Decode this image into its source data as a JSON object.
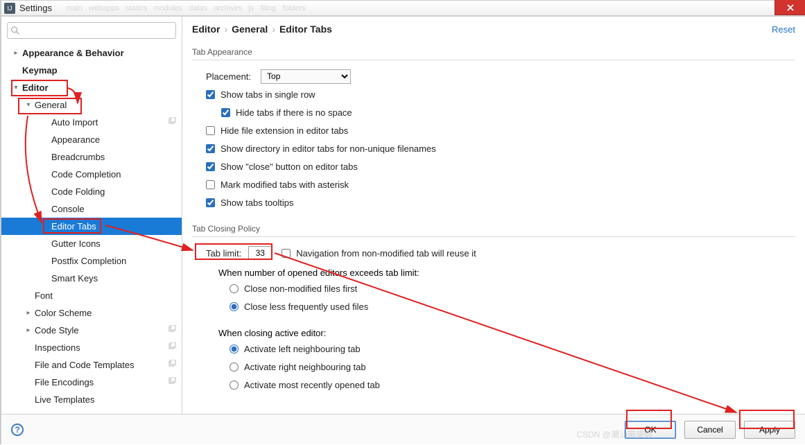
{
  "window": {
    "title": "Settings"
  },
  "search": {
    "placeholder": ""
  },
  "sidebar": {
    "items": [
      {
        "label": "Appearance & Behavior",
        "depth": 0,
        "caret": "closed",
        "bold": true
      },
      {
        "label": "Keymap",
        "depth": 0,
        "caret": "",
        "bold": true
      },
      {
        "label": "Editor",
        "depth": 0,
        "caret": "open",
        "bold": true,
        "hlbox": true
      },
      {
        "label": "General",
        "depth": 1,
        "caret": "open",
        "hlbox": true
      },
      {
        "label": "Auto Import",
        "depth": 2,
        "copy": true
      },
      {
        "label": "Appearance",
        "depth": 2
      },
      {
        "label": "Breadcrumbs",
        "depth": 2
      },
      {
        "label": "Code Completion",
        "depth": 2
      },
      {
        "label": "Code Folding",
        "depth": 2
      },
      {
        "label": "Console",
        "depth": 2
      },
      {
        "label": "Editor Tabs",
        "depth": 2,
        "selected": true,
        "hlbox": true
      },
      {
        "label": "Gutter Icons",
        "depth": 2
      },
      {
        "label": "Postfix Completion",
        "depth": 2
      },
      {
        "label": "Smart Keys",
        "depth": 2
      },
      {
        "label": "Font",
        "depth": 1,
        "caret": ""
      },
      {
        "label": "Color Scheme",
        "depth": 1,
        "caret": "closed"
      },
      {
        "label": "Code Style",
        "depth": 1,
        "caret": "closed",
        "copy": true
      },
      {
        "label": "Inspections",
        "depth": 1,
        "caret": "",
        "copy": true
      },
      {
        "label": "File and Code Templates",
        "depth": 1,
        "caret": "",
        "copy": true
      },
      {
        "label": "File Encodings",
        "depth": 1,
        "caret": "",
        "copy": true
      },
      {
        "label": "Live Templates",
        "depth": 1,
        "caret": ""
      }
    ]
  },
  "crumbs": {
    "a": "Editor",
    "b": "General",
    "c": "Editor Tabs",
    "reset": "Reset"
  },
  "appearance": {
    "section": "Tab Appearance",
    "placement_label": "Placement:",
    "placement_value": "Top",
    "single_row": "Show tabs in single row",
    "hide_no_space": "Hide tabs if there is no space",
    "hide_ext": "Hide file extension in editor tabs",
    "show_dir": "Show directory in editor tabs for non-unique filenames",
    "show_close": "Show \"close\" button on editor tabs",
    "mark_asterisk": "Mark modified tabs with asterisk",
    "tooltips": "Show tabs tooltips"
  },
  "closing": {
    "section": "Tab Closing Policy",
    "tab_limit_label": "Tab limit:",
    "tab_limit_value": "33",
    "nav_reuse": "Navigation from non-modified tab will reuse it",
    "exceed_heading": "When number of opened editors exceeds tab limit:",
    "close_non_modified": "Close non-modified files first",
    "close_lfu": "Close less frequently used files",
    "active_heading": "When closing active editor:",
    "activate_left": "Activate left neighbouring tab",
    "activate_right": "Activate right neighbouring tab",
    "activate_recent": "Activate most recently opened tab"
  },
  "footer": {
    "ok": "OK",
    "cancel": "Cancel",
    "apply": "Apply"
  },
  "watermark": "CSDN @潮汕带货你"
}
